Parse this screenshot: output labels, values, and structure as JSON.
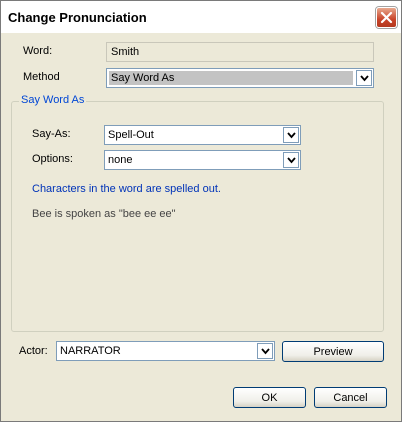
{
  "window": {
    "title": "Change Pronunciation"
  },
  "fields": {
    "word_label": "Word:",
    "word_value": "Smith",
    "method_label": "Method",
    "method_value": "Say Word As"
  },
  "group": {
    "title": "Say Word As",
    "say_as_label": "Say-As:",
    "say_as_value": "Spell-Out",
    "options_label": "Options:",
    "options_value": "none",
    "description": "Characters in the word are spelled out.",
    "example": "Bee is spoken as \"bee ee ee\""
  },
  "actor": {
    "label": "Actor:",
    "value": "NARRATOR",
    "preview_label": "Preview"
  },
  "buttons": {
    "ok": "OK",
    "cancel": "Cancel"
  },
  "icons": [
    "close-icon",
    "chevron-down-icon"
  ]
}
